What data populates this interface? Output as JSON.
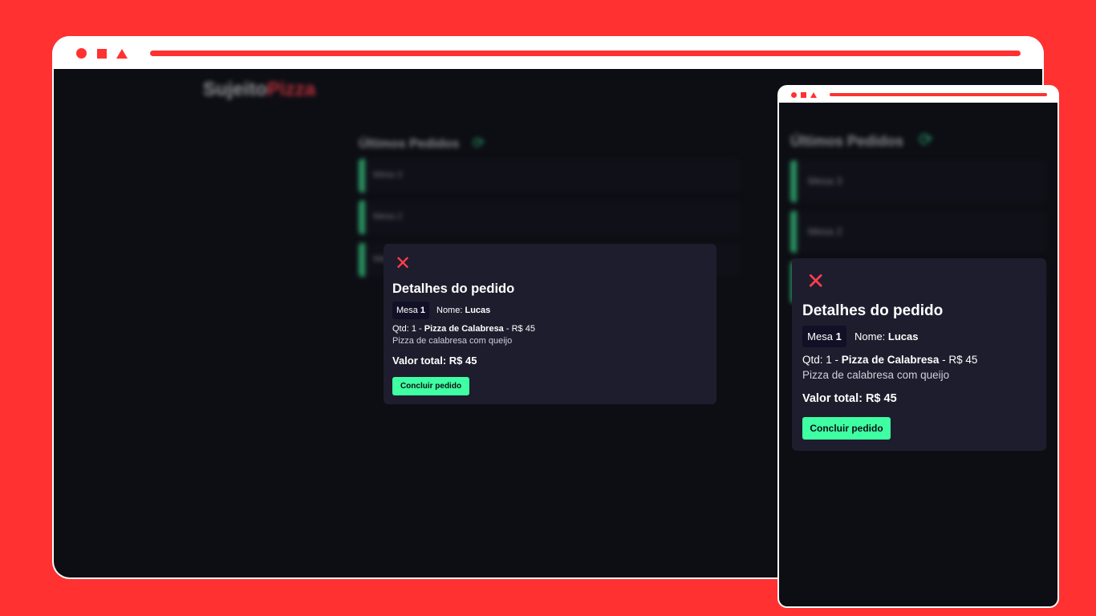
{
  "brand": {
    "logo_part1": "Sujeito",
    "logo_part2": "Pizza"
  },
  "orders_list": {
    "title": "Últimos Pedidos",
    "refresh_icon": "refresh-icon",
    "items": [
      {
        "label": "Mesa 3"
      },
      {
        "label": "Mesa 2"
      },
      {
        "label": "Mesa 1"
      }
    ]
  },
  "modal": {
    "close_icon": "close-icon",
    "title": "Detalhes do pedido",
    "mesa_label": "Mesa",
    "mesa_number": "1",
    "name_label": "Nome:",
    "name_value": "Lucas",
    "item_qty_label": "Qtd: 1 - ",
    "item_name": "Pizza de Calabresa",
    "item_price": " - R$ 45",
    "item_description": "Pizza de calabresa com queijo",
    "total": "Valor total: R$ 45",
    "confirm_button": "Concluir pedido"
  },
  "colors": {
    "background": "#ff3131",
    "screen": "#0d0e14",
    "modal": "#1d1d2e",
    "accent_green": "#3fffa3",
    "accent_red": "#ff3f4b"
  }
}
